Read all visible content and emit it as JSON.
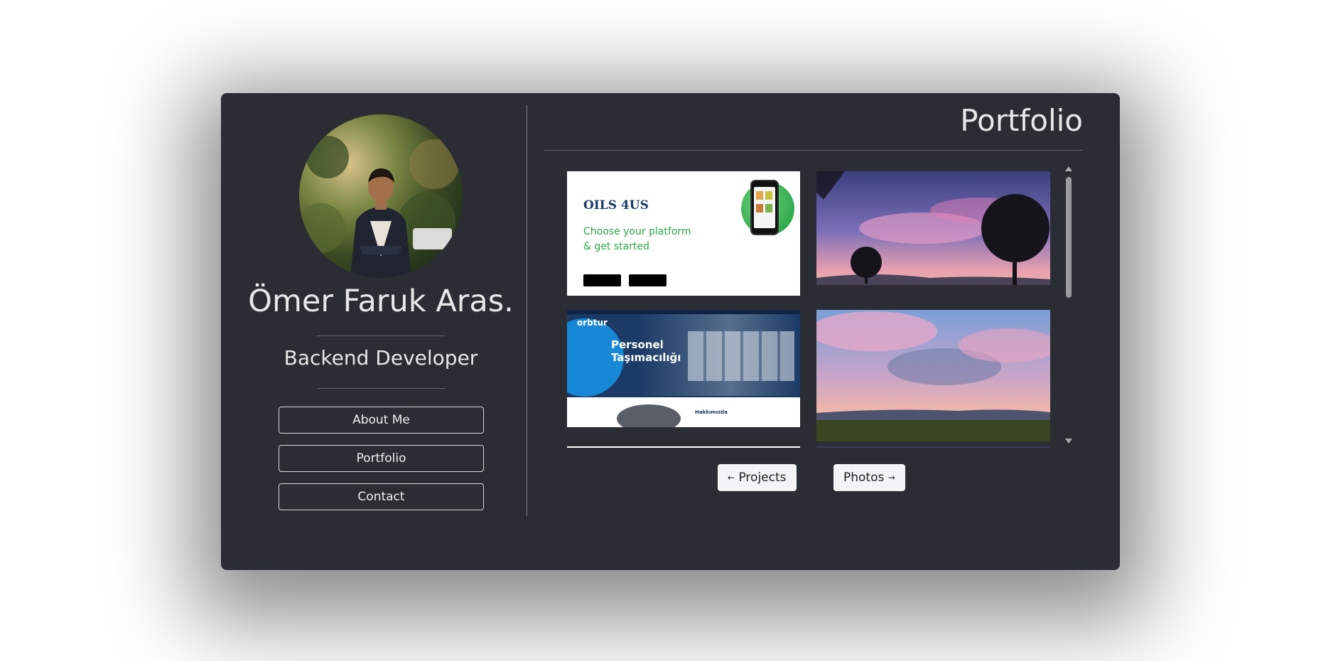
{
  "profile": {
    "name": "Ömer Faruk Aras.",
    "role": "Backend Developer"
  },
  "nav": {
    "about": "About Me",
    "portfolio": "Portfolio",
    "contact": "Contact"
  },
  "portfolio": {
    "title": "Portfolio",
    "oils": {
      "brand": "OILS 4US",
      "tagline_1": "Choose your platform",
      "tagline_2": "& get started"
    },
    "orbtur": {
      "brand": "orbtur",
      "headline_1": "Personel",
      "headline_2": "Taşımacılığı",
      "section": "Hakkımızda"
    },
    "prev_label": "Projects",
    "next_label": "Photos",
    "prev_icon": "arrow-left-icon",
    "next_icon": "arrow-right-icon"
  },
  "colors": {
    "card_bg": "#2a2d33",
    "green": "#2aa84a",
    "navy": "#1c3a66"
  }
}
